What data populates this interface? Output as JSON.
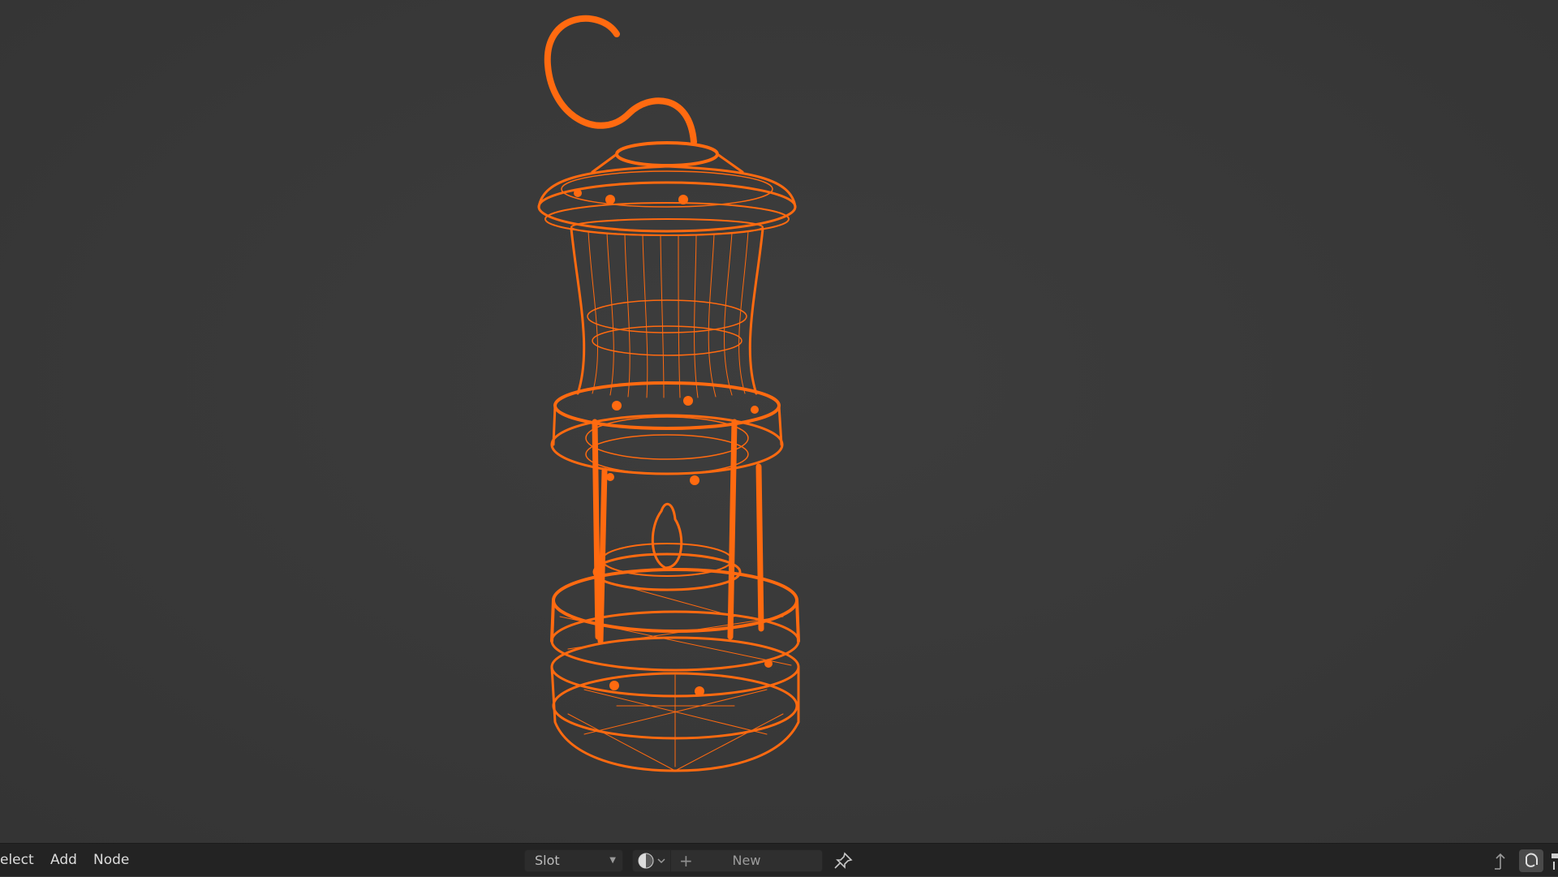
{
  "header_menu": {
    "select_label": "elect",
    "add_label": "Add",
    "node_label": "Node"
  },
  "material": {
    "slot_label": "Slot",
    "new_label": "New"
  },
  "icons": {
    "slot_dropdown": "chevron-down-icon",
    "material_browse": "material-sphere-icon",
    "new_material": "plus-icon",
    "pin": "pin-icon",
    "parent_node_tree": "arrow-up-icon",
    "snap": "magnet-icon"
  },
  "colors": {
    "wireframe_selected": "#ff6a10",
    "viewport_background": "#3a3a3a",
    "header_background": "#232323"
  }
}
